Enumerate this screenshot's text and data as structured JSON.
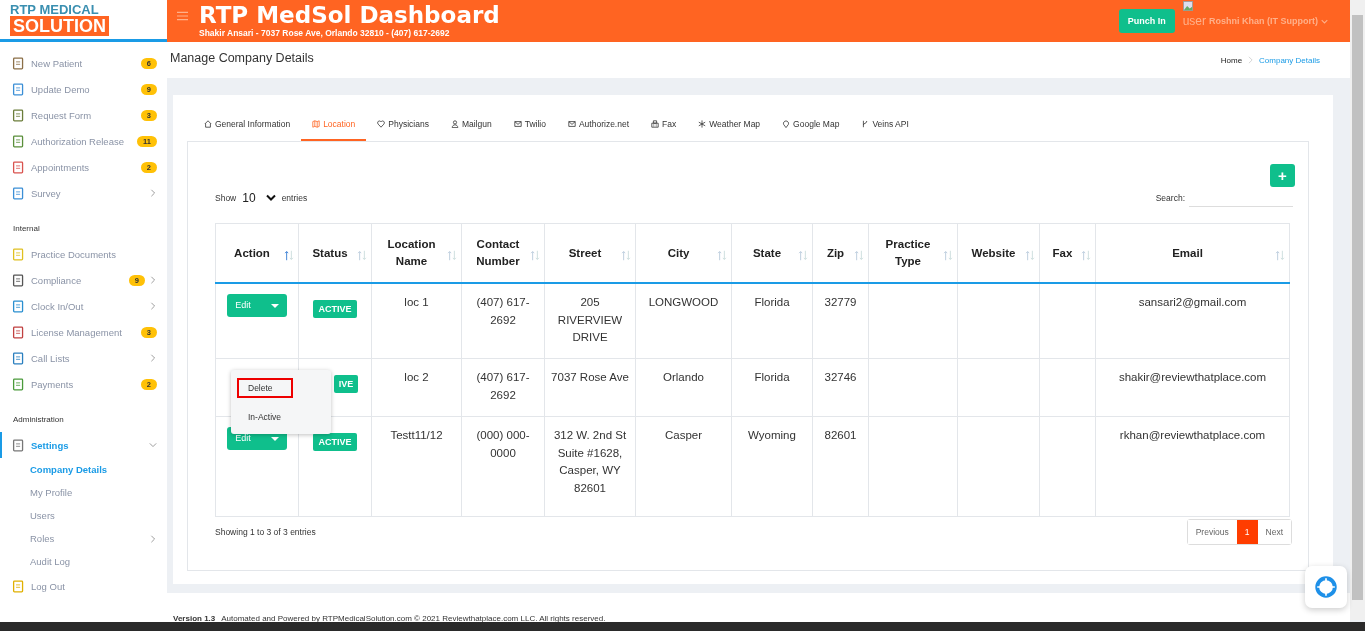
{
  "logo": {
    "line1": "RTP MEDICAL",
    "line2": "SOLUTION"
  },
  "header": {
    "title": "RTP MedSol Dashboard",
    "subtitle": "Shakir Ansari - 7037 Rose Ave, Orlando 32810 - (407) 617-2692",
    "punch_button": "Punch In",
    "user_alt": "user",
    "user_name": "Roshni Khan (IT Support)"
  },
  "sidebar": {
    "sections": [
      {
        "items": [
          {
            "label": "New Patient",
            "badge": "6",
            "expandable": false,
            "selected": false
          },
          {
            "label": "Update Demo",
            "badge": "9",
            "expandable": false,
            "selected": false
          },
          {
            "label": "Request Form",
            "badge": "3",
            "expandable": false,
            "selected": false
          },
          {
            "label": "Authorization Release",
            "badge": "11",
            "expandable": false,
            "selected": false
          },
          {
            "label": "Appointments",
            "badge": "2",
            "expandable": false,
            "selected": false
          },
          {
            "label": "Survey",
            "expandable": true,
            "expanded": false,
            "selected": false
          }
        ]
      },
      {
        "heading": "Internal",
        "items": [
          {
            "label": "Practice Documents",
            "expandable": false,
            "selected": false
          },
          {
            "label": "Compliance",
            "badge": "9",
            "expandable": true,
            "expanded": false,
            "selected": false
          },
          {
            "label": "Clock In/Out",
            "expandable": true,
            "expanded": false,
            "selected": false
          },
          {
            "label": "License Management",
            "badge": "3",
            "expandable": false,
            "selected": false
          },
          {
            "label": "Call Lists",
            "expandable": true,
            "expanded": false,
            "selected": false
          },
          {
            "label": "Payments",
            "badge": "2",
            "expandable": false,
            "selected": false
          }
        ]
      },
      {
        "heading": "Administration",
        "items": [
          {
            "label": "Settings",
            "expandable": true,
            "expanded": true,
            "selected": true,
            "children": [
              {
                "label": "Company Details",
                "selected": true,
                "expandable": false
              },
              {
                "label": "My Profile",
                "selected": false,
                "expandable": false
              },
              {
                "label": "Users",
                "selected": false,
                "expandable": false
              },
              {
                "label": "Roles",
                "selected": false,
                "expandable": true
              },
              {
                "label": "Audit Log",
                "selected": false,
                "expandable": false
              }
            ]
          },
          {
            "label": "Log Out",
            "expandable": false,
            "selected": false
          }
        ]
      }
    ]
  },
  "page": {
    "title": "Manage Company Details",
    "breadcrumb": [
      {
        "label": "Home",
        "selected": false
      },
      {
        "label": "Company Details",
        "selected": true
      }
    ]
  },
  "tabs": [
    {
      "label": "General Information",
      "selected": false
    },
    {
      "label": "Location",
      "selected": true
    },
    {
      "label": "Physicians",
      "selected": false
    },
    {
      "label": "Mailgun",
      "selected": false
    },
    {
      "label": "Twilio",
      "selected": false
    },
    {
      "label": "Authorize.net",
      "selected": false
    },
    {
      "label": "Fax",
      "selected": false
    },
    {
      "label": "Weather Map",
      "selected": false
    },
    {
      "label": "Google Map",
      "selected": false
    },
    {
      "label": "Veins API",
      "selected": false
    }
  ],
  "table_controls": {
    "show_label": "Show",
    "page_size": "10",
    "entries_label": "entries",
    "search_label": "Search:",
    "add_button": "+"
  },
  "table": {
    "columns": [
      {
        "label": "Action",
        "sorted": true
      },
      {
        "label": "Status",
        "sorted": false
      },
      {
        "label": "Location Name",
        "sorted": false
      },
      {
        "label": "Contact Number",
        "sorted": false
      },
      {
        "label": "Street",
        "sorted": false
      },
      {
        "label": "City",
        "sorted": false
      },
      {
        "label": "State",
        "sorted": false
      },
      {
        "label": "Zip",
        "sorted": false
      },
      {
        "label": "Practice Type",
        "sorted": false
      },
      {
        "label": "Website",
        "sorted": false
      },
      {
        "label": "Fax",
        "sorted": false
      },
      {
        "label": "Email",
        "sorted": false
      }
    ],
    "rows": [
      {
        "action": "Edit",
        "status": "ACTIVE",
        "location_name": "loc 1",
        "contact_number": "(407) 617-2692",
        "street": "205 RIVERVIEW DRIVE",
        "city": "LONGWOOD",
        "state": "Florida",
        "zip": "32779",
        "email": "sansari2@gmail.com"
      },
      {
        "status": "IVE",
        "location_name": "loc 2",
        "contact_number": "(407) 617-2692",
        "street": "7037 Rose Ave",
        "city": "Orlando",
        "state": "Florida",
        "zip": "32746",
        "email": "shakir@reviewthatplace.com"
      },
      {
        "action": "Edit",
        "status": "ACTIVE",
        "location_name": "Testt11/12",
        "contact_number": "(000) 000-0000",
        "street": "312 W. 2nd St Suite #1628, Casper, WY 82601",
        "city": "Casper",
        "state": "Wyoming",
        "zip": "82601",
        "email": "rkhan@reviewthatplace.com"
      }
    ]
  },
  "action_menu": {
    "items": [
      {
        "label": "Delete",
        "selected": true
      },
      {
        "label": "In-Active",
        "selected": false
      }
    ]
  },
  "table_info": "Showing 1 to 3 of 3 entries",
  "pagination": [
    {
      "label": "Previous",
      "selected": false
    },
    {
      "label": "1",
      "selected": true
    },
    {
      "label": "Next",
      "selected": false
    }
  ],
  "footer": {
    "version": "Version 1.3",
    "text": "Automated and Powered by RTPMedicalSolution.com © 2021 Reviewthatplace.com LLC. All rights reserved."
  }
}
